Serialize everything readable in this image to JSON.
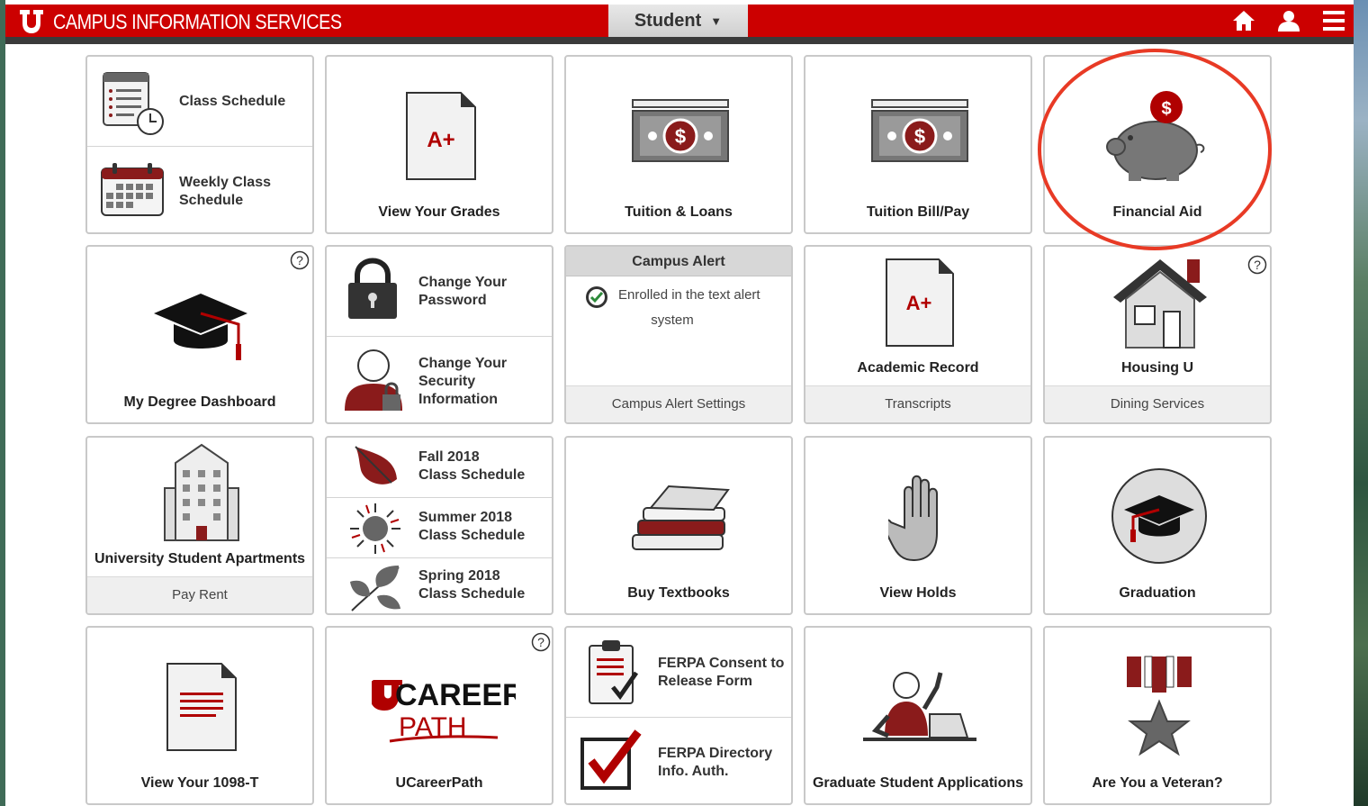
{
  "header": {
    "brand": "CAMPUS INFORMATION SERVICES",
    "role": "Student",
    "icons": [
      "home-icon",
      "user-icon",
      "menu-icon"
    ]
  },
  "colors": {
    "brand_red": "#cc0000",
    "dark_red": "#8a1b1b",
    "icon_gray": "#7a7a7a",
    "highlight": "#e83a25"
  },
  "tiles": {
    "class_schedule": "Class Schedule",
    "weekly_class_schedule_1": "Weekly Class",
    "weekly_class_schedule_2": "Schedule",
    "view_grades": "View Your Grades",
    "tuition_loans": "Tuition & Loans",
    "tuition_bill": "Tuition Bill/Pay",
    "financial_aid": "Financial Aid",
    "degree_dashboard": "My Degree Dashboard",
    "change_password_1": "Change Your",
    "change_password_2": "Password",
    "change_security_1": "Change Your",
    "change_security_2": "Security",
    "change_security_3": "Information",
    "campus_alert": {
      "title": "Campus Alert",
      "status_1": "Enrolled in the text alert",
      "status_2": "system",
      "settings": "Campus Alert Settings"
    },
    "academic_record": "Academic Record",
    "transcripts": "Transcripts",
    "housing": "Housing U",
    "dining": "Dining Services",
    "apartments": "University Student Apartments",
    "pay_rent": "Pay Rent",
    "fall_1": "Fall 2018",
    "fall_2": "Class Schedule",
    "summer_1": "Summer 2018",
    "summer_2": "Class Schedule",
    "spring_1": "Spring 2018",
    "spring_2": "Class Schedule",
    "textbooks": "Buy Textbooks",
    "holds": "View Holds",
    "graduation": "Graduation",
    "form_1098t": "View Your 1098-T",
    "ucareer": "UCareerPath",
    "ucareer_logo_top": "CAREER",
    "ucareer_logo_bottom": "PATH",
    "ferpa_consent_1": "FERPA Consent to",
    "ferpa_consent_2": "Release Form",
    "ferpa_directory_1": "FERPA Directory",
    "ferpa_directory_2": "Info. Auth.",
    "grad_apps": "Graduate Student Applications",
    "veteran": "Are You a Veteran?",
    "grade_mark": "A+",
    "dollar": "$"
  }
}
